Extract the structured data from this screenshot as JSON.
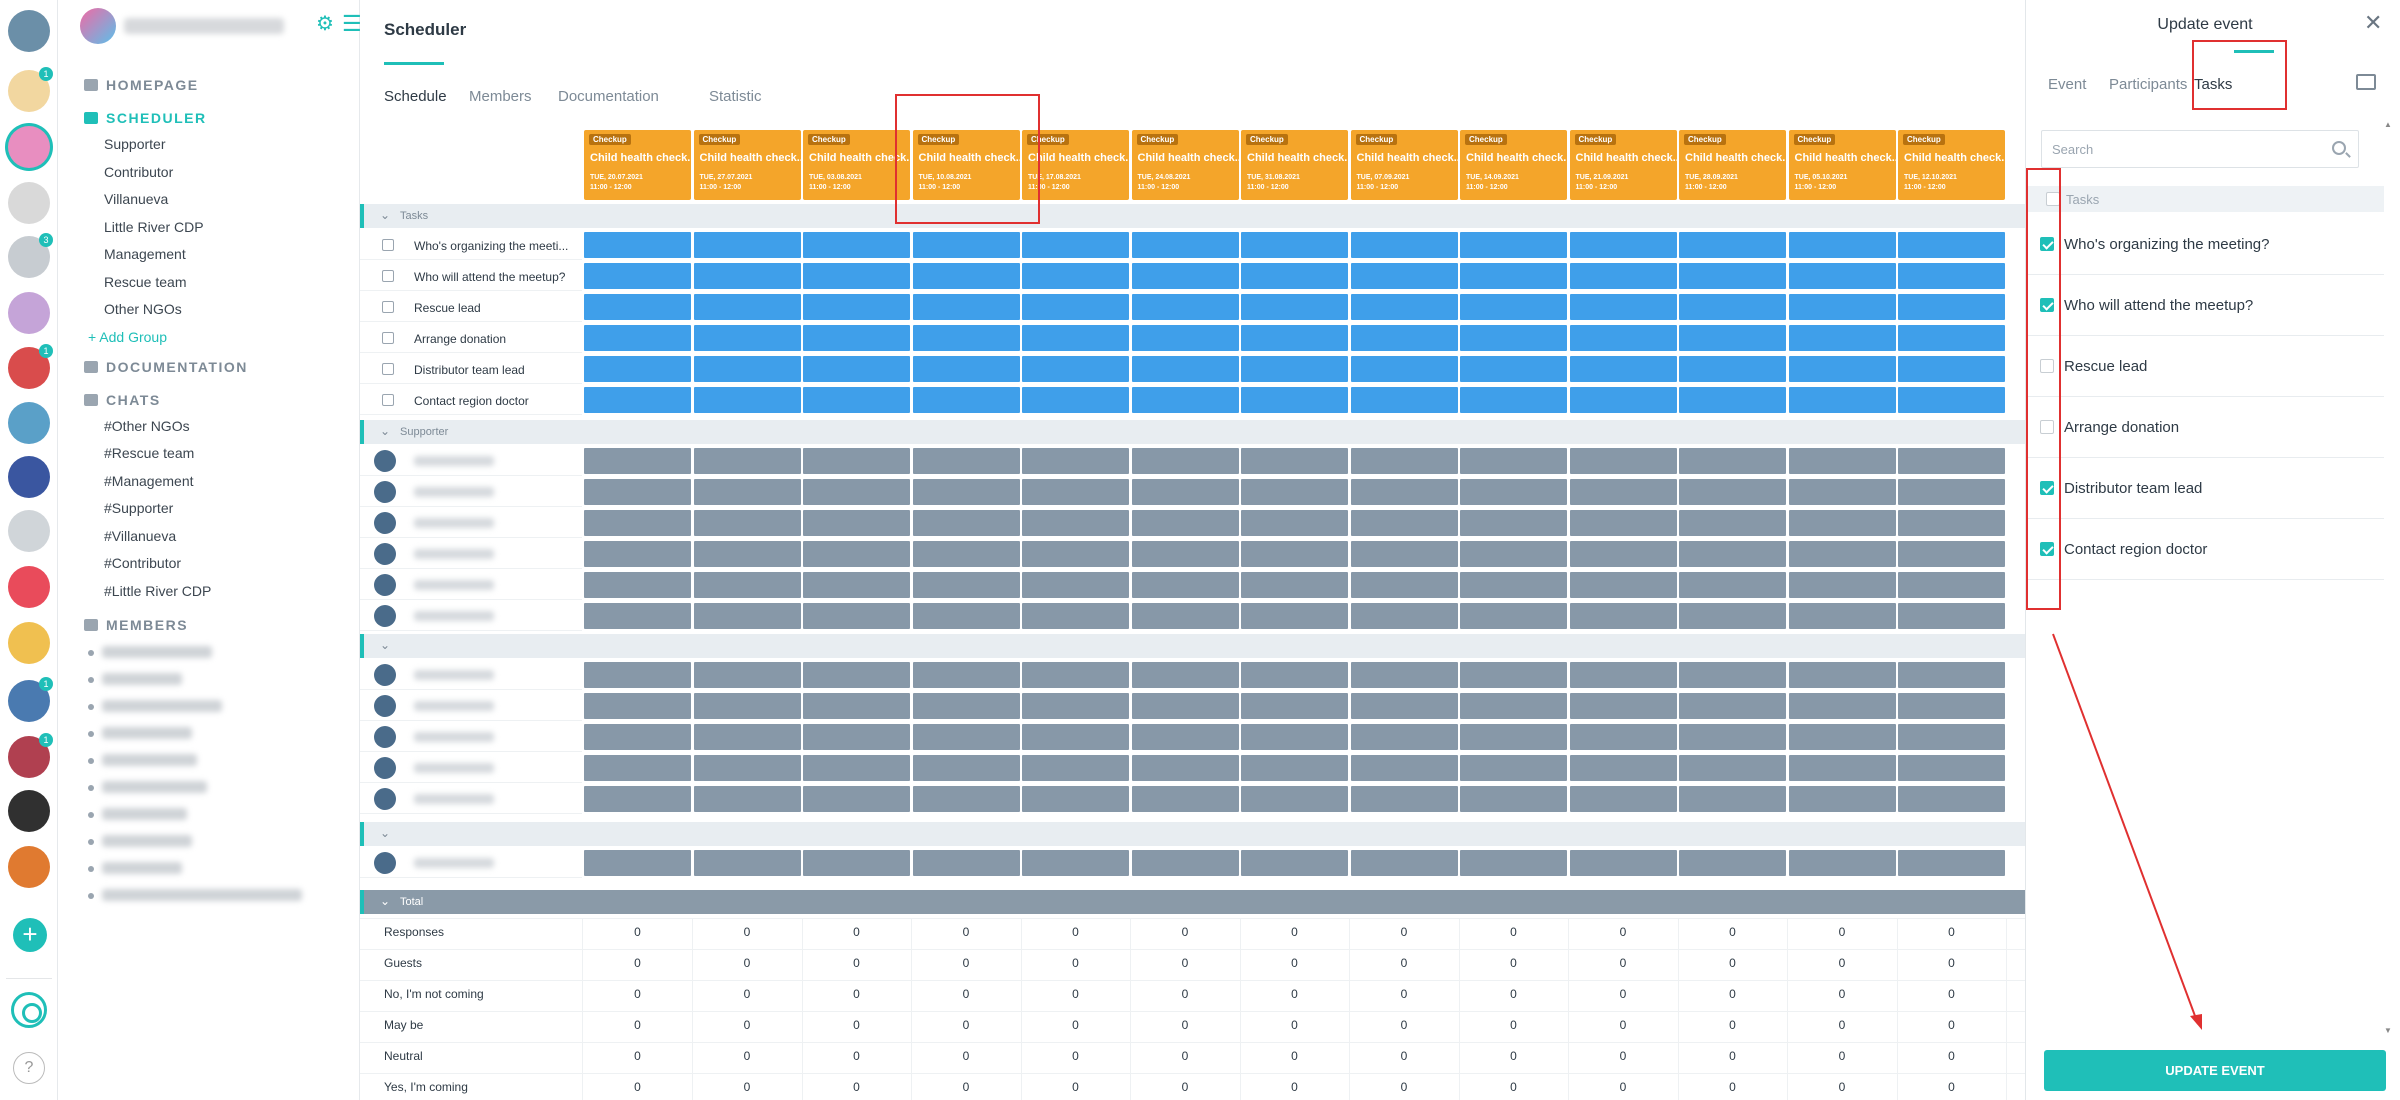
{
  "rail": {
    "badges": [
      "1",
      "3",
      "1",
      "1",
      "1"
    ]
  },
  "nav": {
    "sections": {
      "homepage": "HOMEPAGE",
      "scheduler": "SCHEDULER",
      "documentation": "DOCUMENTATION",
      "chats": "CHATS",
      "members": "MEMBERS"
    },
    "groups": [
      "Supporter",
      "Contributor",
      "Villanueva",
      "Little River CDP",
      "Management",
      "Rescue team",
      "Other NGOs"
    ],
    "add_group": "+ Add Group",
    "chats": [
      "#Other NGOs",
      "#Rescue team",
      "#Management",
      "#Supporter",
      "#Villanueva",
      "#Contributor",
      "#Little River CDP"
    ]
  },
  "main": {
    "title": "Scheduler",
    "tabs": [
      "Schedule",
      "Members",
      "Documentation",
      "Statistic"
    ],
    "event_tag": "Checkup",
    "event_name": "Child health check...",
    "event_dates": [
      "TUE, 20.07.2021",
      "TUE, 27.07.2021",
      "TUE, 03.08.2021",
      "TUE, 10.08.2021",
      "TUE, 17.08.2021",
      "TUE, 24.08.2021",
      "TUE, 31.08.2021",
      "TUE, 07.09.2021",
      "TUE, 14.09.2021",
      "TUE, 21.09.2021",
      "TUE, 28.09.2021",
      "TUE, 05.10.2021",
      "TUE, 12.10.2021"
    ],
    "event_time": "11:00 - 12:00",
    "tasks_group": "Tasks",
    "tasks": [
      "Who's organizing the meeti...",
      "Who will attend the meetup?",
      "Rescue lead",
      "Arrange donation",
      "Distributor team lead",
      "Contact region doctor"
    ],
    "supporter_group": "Supporter",
    "total_group": "Total",
    "totals": [
      {
        "label": "Responses",
        "value": "0"
      },
      {
        "label": "Guests",
        "value": "0"
      },
      {
        "label": "No, I'm not coming",
        "value": "0"
      },
      {
        "label": "May be",
        "value": "0"
      },
      {
        "label": "Neutral",
        "value": "0"
      },
      {
        "label": "Yes, I'm coming",
        "value": "0"
      }
    ]
  },
  "panel": {
    "title": "Update event",
    "tabs": [
      "Event",
      "Participants",
      "Tasks"
    ],
    "search_placeholder": "Search",
    "tasks_header": "Tasks",
    "tasks": [
      {
        "label": "Who's organizing the meeting?",
        "checked": true
      },
      {
        "label": "Who will attend the meetup?",
        "checked": true
      },
      {
        "label": "Rescue lead",
        "checked": false
      },
      {
        "label": "Arrange donation",
        "checked": false
      },
      {
        "label": "Distributor team lead",
        "checked": true
      },
      {
        "label": "Contact region doctor",
        "checked": true
      }
    ],
    "update_button": "UPDATE EVENT"
  },
  "colors": {
    "accent": "#1fbfb8",
    "event": "#f4a52a",
    "task_cell": "#3f9fea",
    "member_cell": "#8798a8",
    "annotation": "#e03030"
  }
}
